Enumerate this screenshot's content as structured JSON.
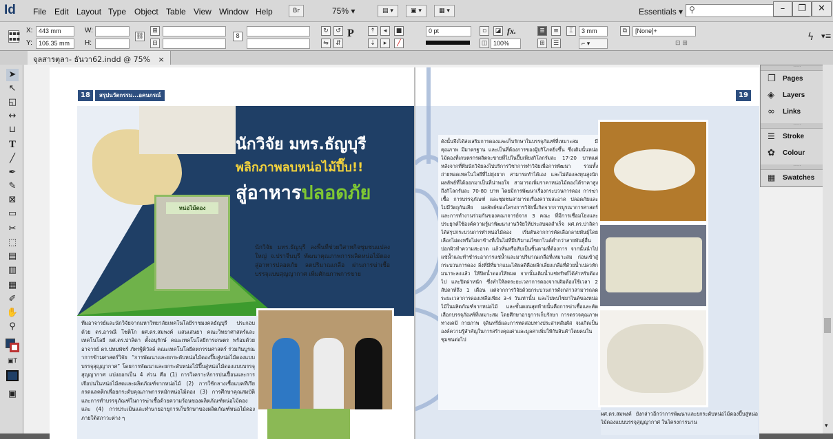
{
  "app": {
    "logo": "Id",
    "menus": [
      "File",
      "Edit",
      "Layout",
      "Type",
      "Object",
      "Table",
      "View",
      "Window",
      "Help"
    ],
    "bridge_label": "Br",
    "zoom": "75% ▾",
    "workspace": "Essentials ▾",
    "search_placeholder": ""
  },
  "window_controls": {
    "minimize": "–",
    "restore": "❐",
    "close": "✕"
  },
  "control": {
    "x_label": "X:",
    "x_value": "443 mm",
    "y_label": "Y:",
    "y_value": "106.35 mm",
    "w_label": "W:",
    "w_value": "",
    "h_label": "H:",
    "h_value": "",
    "stroke_weight": "0 pt",
    "opacity": "100%",
    "gap": "3 mm",
    "object_style": "[None]+"
  },
  "document_tab": {
    "title": "จุลสารตุลา- ธันวา62.indd @ 75%",
    "close": "×"
  },
  "panels": {
    "items": [
      {
        "label": "Pages",
        "icon": "pages-icon"
      },
      {
        "label": "Layers",
        "icon": "layers-icon"
      },
      {
        "label": "Links",
        "icon": "links-icon"
      },
      {
        "label": "Stroke",
        "icon": "stroke-icon"
      },
      {
        "label": "Colour",
        "icon": "colour-icon"
      },
      {
        "label": "Swatches",
        "icon": "swatches-icon"
      }
    ]
  },
  "page_left": {
    "folio": "18",
    "section": "สรุปนวัตกรรม...อคนกรณ์",
    "headline1": "นักวิจัย มทร.ธัญบุรี",
    "headline2": "พลิกภาพลบหน่อไม้ปี๊บ!!",
    "headline3a": "สู่อาหาร",
    "headline3b": "ปลอดภัย",
    "product_label": "หน่อไม้ดอง",
    "intro": "นักวิจัย มทร.ธัญบุรี ลงพื้นที่ช่วยวิสาหกิจชุมชนแปลงใหญ่ จ.ปราจีนบุรี พัฒนาคุณภาพการผลิตหน่อไม้ดอง สู่อาหารปลอดภัย ลดปริมาณเกลือ ผ่านการฆ่าเชื้อ บรรจุแบบสุญญากาศ เพิ่มศักยภาพการขาย",
    "body": "ทีมอาจารย์และนักวิจัยจากมหาวิทยาลัยเทคโนโลยีราชมงคลธัญบุรี ประกอบด้วย ดร.อารณี โชติโก ผศ.ดร.สมพงค์ แสนเสนยา คณะวิทยาศาสตร์และเทคโนโลยี ผศ.ดร.ปาลิดา ตั้งอนุรักษ์ คณะเทคโนโลยีการเกษตร พร้อมด้วย อาจารย์ ดร.ปทมพัชร์ ภัทรฐิติวัลล์ คณะเทคโนโลยีคหกรรมศาสตร์ ร่วมกันบูรณาการข้ามศาสตร์วิจัย “การพัฒนาและยกระดับหน่อไม้ดองปี๊บสู่หน่อไม้ดองแบบบรรจุสุญญากาศ” โดยการพัฒนาและยกระดับหน่อไม้ปี๊บสู่หน่อไม้ดองแบบบรรจุสุญญากาศ แบ่งออกเป็น 4 ส่วน คือ (1) การวิเคราะห์การปนเปื้อนและการเจือปนในหน่อไม้สดและผลิตภัณฑ์จากหน่อไม้ (2) การใช้กลางเชื้อแบคทีเรียกรดแลคติกเพื่อยกระดับคุณภาพการหมักหน่อไม้ดอง (3) การศึกษาคุณสมบัติและการทำบรรจุภัณฑ์ในการฆ่าเชื้อด้วยความร้อนของผลิตภัณฑ์หน่อไม้ดอง และ (4) การประเมินและทำนายอายุการเก็บรักษาของผลิตภัณฑ์หน่อไม้ดองภายใต้สภาวะต่าง ๆ"
  },
  "page_right": {
    "folio": "19",
    "col1": "ดังนั้นจึงได้ส่งเสริมการดองและเก็บรักษาในบรรจุภัณฑ์ที่เหมาะสม มีคุณภาพ มีมาตรฐาน และเป็นที่ต้องการของผู้บริโภคยิ่งขึ้น ซึ่งเดิมนั้นหน่อไม้ดองที่เกษตรกรผลิตจะขายที่ไปในปี๊บเพียงกิโลกรัมละ 17-20 บาทแต่หลังจากที่ทีมนักวิจัยลงไปบริการวิชาการทำวิจัยเพื่อการพัฒนา รวมทั้งถ่ายทอดเทคโนโลยีที่ไม่ยุ่งยาก สามารถทำได้เอง และไม่ต้องลงทุนสูงนัก ผลลัพธ์ที่ได้ออกมาเป็นที่น่าพอใจ สามารถเพิ่มราคาหน่อไม้ดองได้ราคาสูงถึงกิโลกรัมละ 70-80 บาท โดยมีการพัฒนาเรื่องกระบวนการดอง การฆ่าเชื้อ การบรรจุภัณฑ์ และชุมชนสามารถเรื่องความสะอาด ปลอดภัยและไม่มีวัตถุกันเสีย ผลลัพธ์ของโครงการวิจัยนี้เกิดจากการบูรณาการศาสตร์และการทำงานร่วมกันของคณาจารย์จาก 3 คณะ ที่มีการเชื่อมโยงและประยุกต์ใช้องค์ความรู้มาพัฒนางานวิจัยให้ประสบผลสำเร็จ ผศ.ดร.ปาลิดา ได้สรุปกระบวนการทำหน่อไม้ดอง เริ่มต้นจากการคัดเลือกลายพันธุ์โดยเลือกไผ่ตงหรือไผ่จาข้างที่เป็นไผ่ที่มีปริมาณไซยาไนด์ต่ำกว่าสายพันธุ์อื่น ปอกผิวทำความสะอาด แล้วหั่นหรือสับเป็นชิ้นตามที่ต้องการ จากนั้นนำไปแช่น้ำและทำชำระอาการแช่น้ำและมาปริมาณเกลือที่เหมาะสม ก่อนเข้าสู่กระบวนการดอง สิ่งที่มีที่มากแนะได้ผลดีคือหลีกเลี่ยงเกลือที่ด้วยน้ำเปลวหักมนาระลงแล้ว ให้ปิดน้ำดองให้หมด จากนั้นเติมน้ำแช่ทรัพย์ได้สำหรับต้องไป และปิดฝาหนัก ซึ่งทำให้ลดระยะเวลาการดองจากเดิมต้องใช้เวลา 2 สัปดาห์ถึง 1 เดือน แต่จากการวิจัยด้วยกระบวนการดังกล่าวสามารถลดระยะเวลาการดองเหลือเพียง 3-4 วันเท่านั้น และไม่พบไซยาไนด์ของหน่อไม้ในผลิตภัณฑ์จากหน่อไม้ และขั้นตอนสุดท้ายนั้นคือการฆ่าเชื้อและคัดเลือกบรรจุภัณฑ์ที่เหมาะสม โดยศึกษาอายุการเก็บรักษา การตรวจคุณภาพทางเคมี กายภาพ จุลินทรีย์และการทดสอบทางประสาทสัมผัส จนเกิดเป็นองค์ความรู้สำคัญในการสร้างคุณค่าและมูลค่าเพิ่มให้กับสินค้าโดยคนในชุมชนต่อไป",
    "caption": "ผศ.ดร.สมพงค์ ยังกล่าวอีกว่าการพัฒนาและยกระดับหน่อไม้ดองปี๊บสู่หน่อไม้ดองแบบบรรจุสุญญากาศ ในโครงการนาน"
  },
  "colors": {
    "navy": "#1f3f66",
    "green": "#3d9b2e",
    "headline_yellow": "#f2d23c",
    "headline_green": "#7fc832",
    "page_blue_pattern": "#9fb4d4",
    "text_box": "#e5ecf5",
    "folio": "#2d4e7f"
  }
}
